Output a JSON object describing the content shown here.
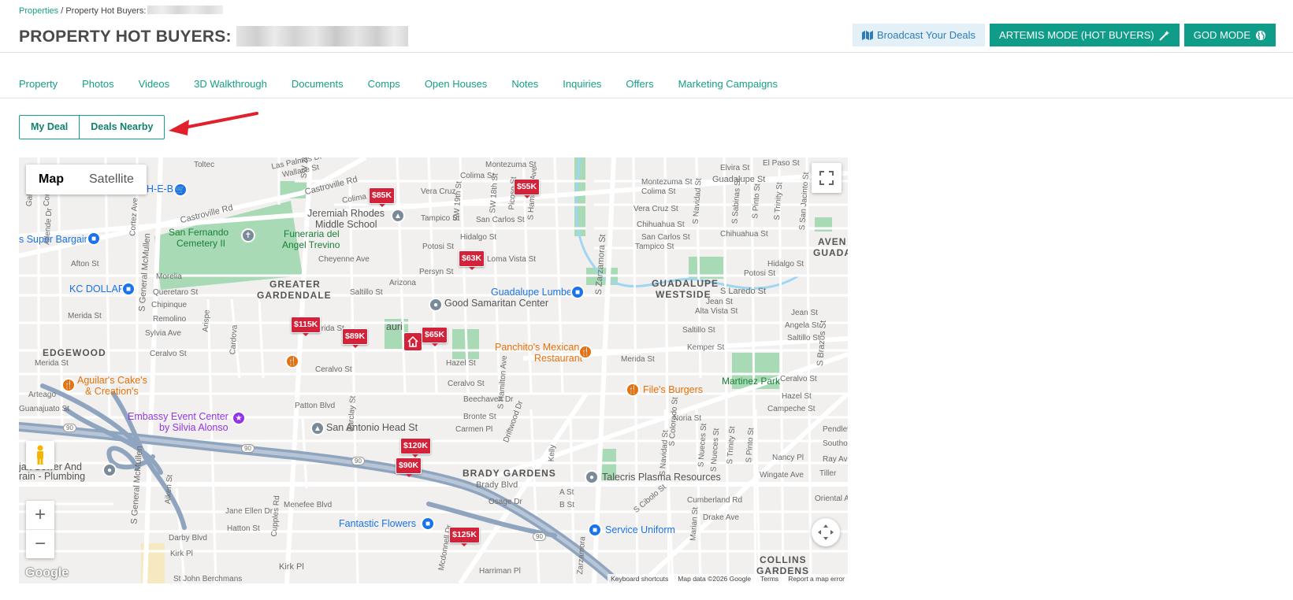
{
  "breadcrumb": {
    "root": "Properties",
    "sep": " / ",
    "current": "Property Hot Buyers:"
  },
  "page": {
    "title": "PROPERTY HOT BUYERS:"
  },
  "actions": {
    "broadcast": "Broadcast Your Deals",
    "artemis": "ARTEMIS MODE (HOT BUYERS)",
    "god": "GOD MODE"
  },
  "tabs": [
    "Property",
    "Photos",
    "Videos",
    "3D Walkthrough",
    "Documents",
    "Comps",
    "Open Houses",
    "Notes",
    "Inquiries",
    "Offers",
    "Marketing Campaigns"
  ],
  "toggle": {
    "my_deal": "My Deal",
    "deals_nearby": "Deals Nearby"
  },
  "map": {
    "type_map": "Map",
    "type_satellite": "Satellite",
    "zoom_in": "+",
    "zoom_out": "−",
    "logo": "Google",
    "attribution": {
      "shortcuts": "Keyboard shortcuts",
      "data": "Map data ©2026 Google",
      "terms": "Terms",
      "report": "Report a map error"
    },
    "prices": [
      "$85K",
      "$55K",
      "$63K",
      "$115K",
      "$89K",
      "$65K",
      "$120K",
      "$90K",
      "$125K"
    ],
    "areas": {
      "greater_gardendale_1": "GREATER",
      "greater_gardendale_2": "GARDENDALE",
      "guadalupe_westside_1": "GUADALUPE",
      "guadalupe_westside_2": "WESTSIDE",
      "edgewood": "EDGEWOOD",
      "brady_gardens": "BRADY GARDENS",
      "collins_gardens_1": "COLLINS",
      "collins_gardens_2": "GARDENS",
      "aven_1": "AVEN",
      "aven_2": "GUADA"
    },
    "places": {
      "heb": "H-E-B",
      "super_bargain": "s Super Bargain",
      "kc_dollar": "KC DOLLAR",
      "san_fernando": "San Fernando",
      "cemetery": "Cemetery II",
      "funeraria_1": "Funeraria del",
      "funeraria_2": "Angel Trevino",
      "jeremiah_1": "Jeremiah Rhodes",
      "jeremiah_2": "Middle School",
      "good_samaritan": "Good Samaritan Center",
      "guadalupe_lumber": "Guadalupe Lumber",
      "panchitos_1": "Panchito's Mexican",
      "panchitos_2": "Restaurant",
      "martinez_park": "Martinez Park",
      "files_burgers": "File's Burgers",
      "aguilars_1": "Aguilar's Cake's",
      "aguilars_2": "& Creation's",
      "embassy_1": "Embassy Event Center",
      "embassy_2": "by Silvia Alonso",
      "sa_head_start": "San Antonio Head St",
      "ajax_1": "jax Sewer And",
      "ajax_2": "rain - Plumbing",
      "talecris": "Talecris Plasma Resources",
      "fantastic_flowers": "Fantastic Flowers",
      "service_uniform": "Service Uniform",
      "laurri": "auri"
    },
    "streets": {
      "castroville_rd_1": "Castroville Rd",
      "castroville_rd_2": "Castroville Rd",
      "vera_cruz": "Vera Cruz",
      "colima_top": "Colima St",
      "montezuma_top": "Montezuma St",
      "colima_left": "Colima St",
      "tampico": "Tampico St",
      "san_carlos": "San Carlos St",
      "hidalgo": "Hidalgo St",
      "potosi": "Potosi St",
      "loma_vista": "Loma Vista St",
      "persyn": "Persyn St",
      "arizona": "Arizona",
      "saltillo": "Saltillo St",
      "cheyenne": "Cheyenne Ave",
      "morelia": "Morelia",
      "queretaro": "Queretaro St",
      "chipinque": "Chipinque",
      "remolino": "Remolino",
      "sylvia": "Sylvia Ave",
      "merida_left": "Merida St",
      "merida_mid": "Merida St",
      "ceralvo_left": "Ceralvo St",
      "ceralvo_mid": "Ceralvo St",
      "ceralvo_mid2": "Ceralvo St",
      "hazel": "Hazel St",
      "beechaven": "Beechaven Dr",
      "bronte": "Bronte St",
      "carmen": "Carmen Pl",
      "patton": "Patton Blvd",
      "brady_blvd": "Brady Blvd",
      "osage": "Osage Dr",
      "menefee": "Menefee Blvd",
      "jane_ellen": "Jane Ellen Dr",
      "hatton": "Hatton St",
      "darby": "Darby Blvd",
      "kirk_pl_left": "Kirk Pl",
      "kirk_pl": "Kirk Pl",
      "harriman": "Harriman Pl",
      "st_john": "St John Berchmans",
      "afton": "Afton St",
      "merida_left2": "Merida St",
      "toltec": "Toltec",
      "wallace": "Wallace St",
      "las_palmas": "Las Palmas Dr",
      "guanajuato": "Guanajuato St",
      "arteago": "Arteago",
      "guadalupe_st": "Guadalupe St",
      "montezuma_right": "Montezuma St",
      "colima_right": "Colima St",
      "elvira": "Elvira St",
      "el_paso": "El Paso St",
      "vera_cruz_right": "Vera Cruz St",
      "chihuahua_1": "Chihuahua St",
      "chihuahua_2": "Chihuahua St",
      "san_carlos_right": "San Carlos St",
      "tampico_right": "Tampico St",
      "hidalgo_right": "Hidalgo St",
      "potosi_right": "Potosi St",
      "s_laredo": "S Laredo St",
      "jean": "Jean St",
      "alta_vista": "Alta Vista St",
      "jean_right": "Jean St",
      "angela": "Angela St",
      "saltillo_right": "Saltillo St",
      "saltillo_right2": "Saltillo St",
      "kemper": "Kemper St",
      "merida_right": "Merida St",
      "ceralvo_right": "Ceralvo St",
      "hazel_right": "Hazel St",
      "campeche": "Campeche St",
      "noria": "Noria St",
      "nancy": "Nancy Pl",
      "wingate": "Wingate Ave",
      "cumberland": "Cumberland Rd",
      "drake": "Drake Ave",
      "pendleton": "Pendleto",
      "southol": "Southol",
      "ray": "Ray Ave",
      "tiller": "Tiller",
      "oriental": "Oriental Av",
      "a_st": "A St",
      "b_st": "B St",
      "s_zarzamora": "S Zarzamora St",
      "s_general_mcmullen": "S General McMullen",
      "s_general_mcmullen_2": "S General McMullen",
      "cupples": "Cupples Rd",
      "barclay": "Barclay St",
      "s_brazos": "S Brazos St",
      "s_hamilton": "S Hamilton Ave",
      "driftwood": "Driftwood Dr",
      "kelly": "Kelly",
      "s_cibolo": "S Cibolo St",
      "s_19th": "SW 19th St",
      "s_18th": "SW 18th St",
      "picoso": "Picoso St",
      "s_hamilton_top": "S Hamilton Ave",
      "cardova": "Cardova",
      "arispe": "Arispe",
      "s_cortez": "Cortez Ave",
      "sw_20": "SW 20",
      "nc_allende": "Allende Dr",
      "navidad": "S Navidad St",
      "s_sabinas": "S Sabinas St",
      "s_pinto": "S Pinto St",
      "s_trinity": "S Trinity St",
      "s_san_jacinto": "S San Jacinto St",
      "s_colorado": "S Colorado St",
      "s_nueces": "S Nueces St",
      "acme": "Aiken St",
      "s_zarz_low": "Zarzamora",
      "hw_90_1": "90",
      "hw_90_2": "90",
      "hw_90_3": "90",
      "hw_90_4": "90",
      "mcdonnell": "Mcdonnell Dr",
      "s_frio": "S Trinity St",
      "marian": "Marian St",
      "s_navidad_low": "S Navidad St",
      "s_pinto_low": "S Pinto St",
      "s_nueces_low": "S Nueces St",
      "corona": "Corona",
      "s_callaghan": "Gallaghan"
    }
  }
}
